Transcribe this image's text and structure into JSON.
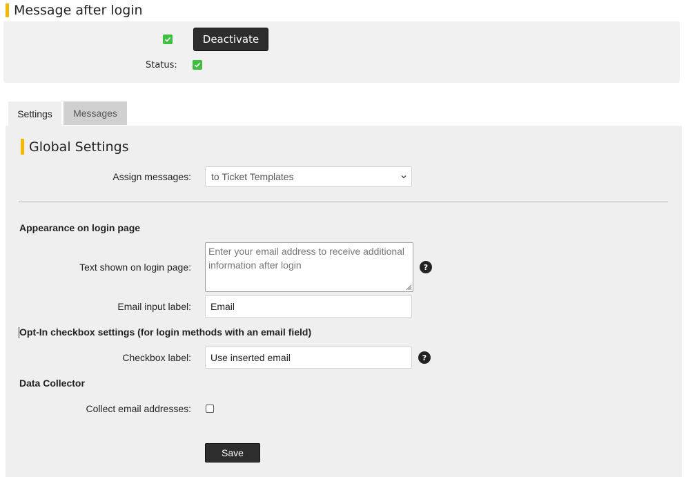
{
  "page": {
    "title": "Message after login"
  },
  "top": {
    "deactivate_label": "Deactivate",
    "status_label": "Status:",
    "status_checked": true,
    "checkbox_checked": true
  },
  "tabs": [
    {
      "label": "Settings",
      "active": true
    },
    {
      "label": "Messages",
      "active": false
    }
  ],
  "global": {
    "title": "Global Settings",
    "assign_label": "Assign messages:",
    "assign_value": "to Ticket Templates"
  },
  "appearance": {
    "heading": "Appearance on login page",
    "text_label": "Text shown on login page:",
    "text_placeholder": "Enter your email address to receive additional information after login",
    "email_label": "Email input label:",
    "email_value": "Email"
  },
  "optin": {
    "heading": "Opt-In checkbox settings (for login methods with an email field)",
    "checkbox_label": "Checkbox label:",
    "checkbox_value": "Use inserted email"
  },
  "collector": {
    "heading": "Data Collector",
    "collect_label": "Collect email addresses:",
    "collect_checked": false
  },
  "save_label": "Save",
  "icons": {
    "check": "check-icon",
    "help": "question-circle-icon",
    "chevron": "chevron-down-icon",
    "resize": "resize-grip-icon"
  },
  "colors": {
    "accent": "#f5b800",
    "check_green": "#3fbf3f",
    "button_dark": "#2d2d2d",
    "panel_bg": "#efefef"
  }
}
